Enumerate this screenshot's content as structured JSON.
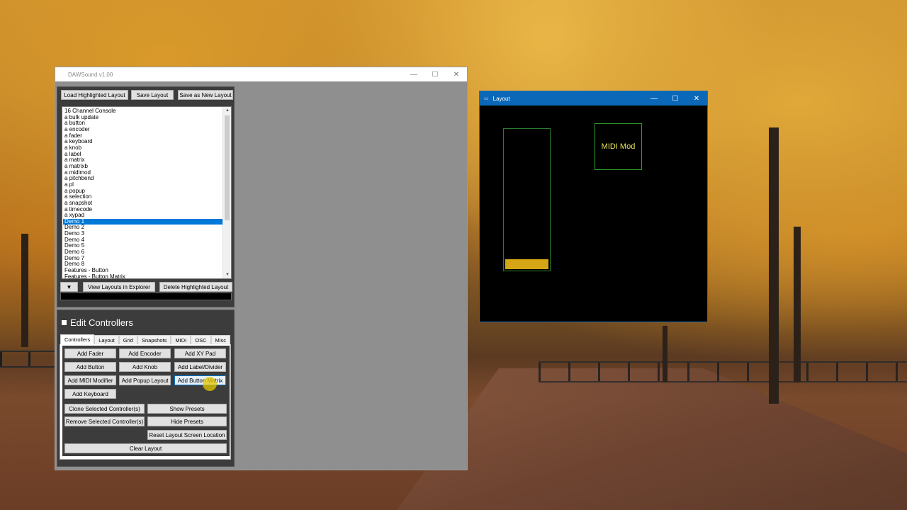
{
  "main_window": {
    "title": "DAWSound  v1.00",
    "minimize": "—",
    "maximize": "☐",
    "close": "✕"
  },
  "layouts_panel": {
    "load_button": "Load Highlighted Layout",
    "save_button": "Save Layout",
    "save_new_button": "Save as New Layout",
    "items": [
      "16 Channel Console",
      "a bulk update",
      "a button",
      "a encoder",
      "a fader",
      "a keyboard",
      "a knob",
      "a label",
      "a matrix",
      "a matrixb",
      "a midimod",
      "a pitchbend",
      "a pl",
      "a popup",
      "a selection",
      "a snapshot",
      "a timecode",
      "a xypad",
      "Demo 1",
      "Demo 2",
      "Demo 3",
      "Demo 4",
      "Demo 5",
      "Demo 6",
      "Demo 7",
      "Demo 8",
      "Features - Button",
      "Features - Button Matrix"
    ],
    "selected_item": "Demo 1",
    "dropdown_arrow": "▼",
    "view_explorer_button": "View Layouts in Explorer",
    "delete_button": "Delete Highlighted Layout"
  },
  "edit_panel": {
    "title": "Edit Controllers",
    "tabs": [
      "Controllers",
      "Layout",
      "Grid",
      "Snapshots",
      "MIDI",
      "OSC",
      "Misc"
    ],
    "active_tab": "Controllers",
    "buttons": {
      "add_fader": "Add Fader",
      "add_encoder": "Add Encoder",
      "add_xy_pad": "Add XY Pad",
      "add_button": "Add Button",
      "add_knob": "Add Knob",
      "add_label": "Add Label/Divider",
      "add_midi_modifier": "Add MIDI Modifier",
      "add_popup": "Add Popup Layout",
      "add_button_matrix": "Add Button Matrix",
      "add_keyboard": "Add Keyboard",
      "clone_selected": "Clone Selected Controller(s)",
      "show_presets": "Show Presets",
      "remove_selected": "Remove Selected Controller(s)",
      "hide_presets": "Hide Presets",
      "reset_location": "Reset Layout Screen Location",
      "clear_layout": "Clear Layout"
    }
  },
  "layout_window": {
    "title": "Layout",
    "minimize": "—",
    "maximize": "☐",
    "close": "✕",
    "midi_mod_label": "MIDI Mod",
    "fader_level": 0.07
  },
  "colors": {
    "selection": "#0078d7",
    "layout_titlebar": "#0b68b8",
    "fader_fill": "#d4a514",
    "control_border": "#2d7a2d",
    "midi_text": "#e8e35a"
  }
}
